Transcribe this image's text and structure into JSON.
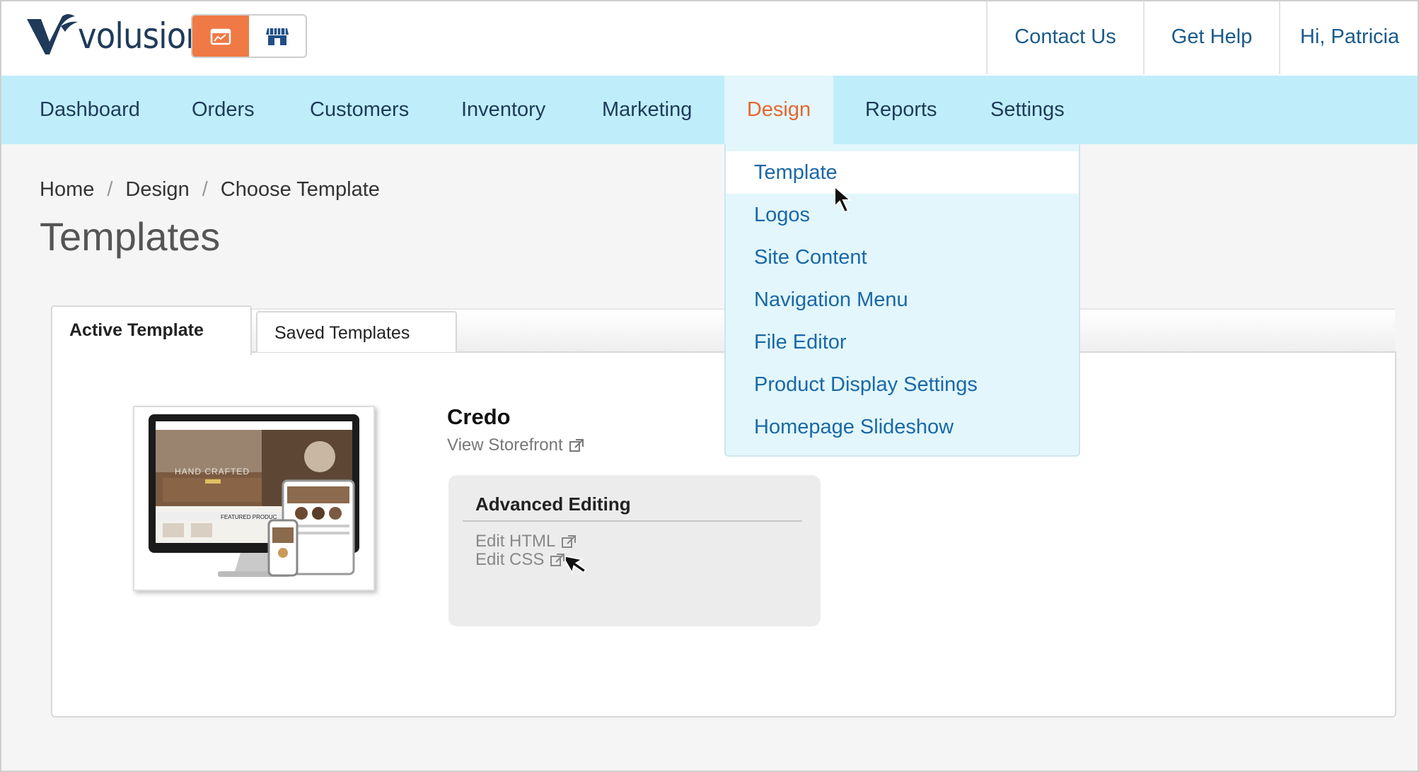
{
  "brand": {
    "name": "volusion",
    "colors": {
      "accent": "#f07a45",
      "nav_bg": "#bfeefa",
      "link": "#1a68a6",
      "active_nav": "#e8652f"
    }
  },
  "header": {
    "mode_switch": {
      "admin_icon": "admin-dashboard-icon",
      "store_icon": "storefront-icon"
    },
    "links": {
      "contact": "Contact Us",
      "help": "Get Help",
      "user": "Hi, Patricia"
    }
  },
  "nav": {
    "items": [
      "Dashboard",
      "Orders",
      "Customers",
      "Inventory",
      "Marketing",
      "Design",
      "Reports",
      "Settings"
    ],
    "active": "Design"
  },
  "design_menu": {
    "items": [
      "Template",
      "Logos",
      "Site Content",
      "Navigation Menu",
      "File Editor",
      "Product Display Settings",
      "Homepage Slideshow"
    ],
    "hovered": "Template"
  },
  "breadcrumb": [
    "Home",
    "Design",
    "Choose Template"
  ],
  "breadcrumb_sep": "/",
  "page_title": "Templates",
  "tabs": {
    "active": "Active Template",
    "saved": "Saved Templates"
  },
  "template": {
    "name": "Credo",
    "view_storefront": "View Storefront",
    "preview_text": {
      "hero": "HAND CRAFTED",
      "featured": "FEATURED PRODUC"
    }
  },
  "advanced_editing": {
    "title": "Advanced Editing",
    "edit_html": "Edit HTML",
    "edit_css": "Edit CSS"
  }
}
